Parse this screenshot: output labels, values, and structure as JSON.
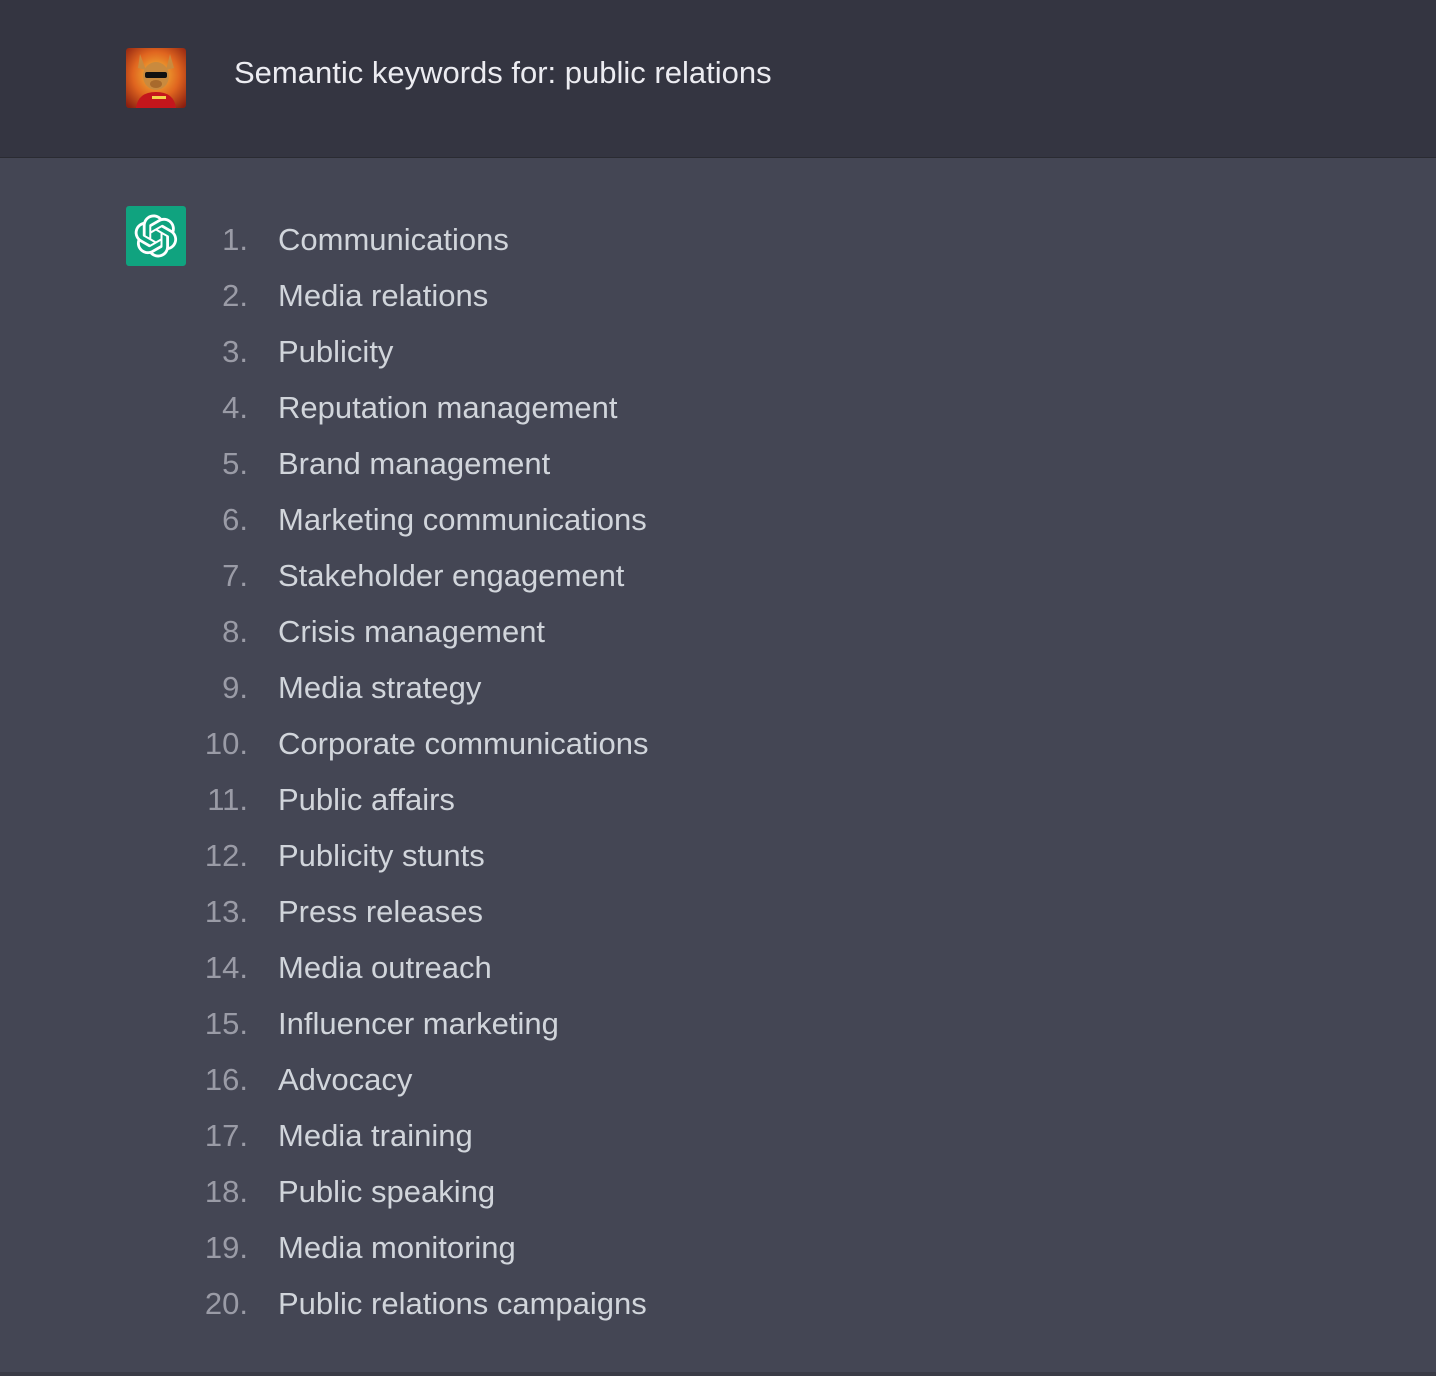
{
  "user_message": {
    "text": "Semantic keywords for: public relations",
    "avatar_icon": "user-avatar-photo"
  },
  "assistant_message": {
    "icon": "openai-logo-icon",
    "icon_bg": "#10a37f",
    "items": [
      {
        "num": "1.",
        "text": "Communications"
      },
      {
        "num": "2.",
        "text": "Media relations"
      },
      {
        "num": "3.",
        "text": "Publicity"
      },
      {
        "num": "4.",
        "text": "Reputation management"
      },
      {
        "num": "5.",
        "text": "Brand management"
      },
      {
        "num": "6.",
        "text": "Marketing communications"
      },
      {
        "num": "7.",
        "text": "Stakeholder engagement"
      },
      {
        "num": "8.",
        "text": "Crisis management"
      },
      {
        "num": "9.",
        "text": "Media strategy"
      },
      {
        "num": "10.",
        "text": "Corporate communications"
      },
      {
        "num": "11.",
        "text": "Public affairs"
      },
      {
        "num": "12.",
        "text": "Publicity stunts"
      },
      {
        "num": "13.",
        "text": "Press releases"
      },
      {
        "num": "14.",
        "text": "Media outreach"
      },
      {
        "num": "15.",
        "text": "Influencer marketing"
      },
      {
        "num": "16.",
        "text": "Advocacy"
      },
      {
        "num": "17.",
        "text": "Media training"
      },
      {
        "num": "18.",
        "text": "Public speaking"
      },
      {
        "num": "19.",
        "text": "Media monitoring"
      },
      {
        "num": "20.",
        "text": "Public relations campaigns"
      }
    ]
  },
  "colors": {
    "user_bg": "#343541",
    "assistant_bg": "#444654",
    "text": "#d1d5db",
    "number": "#9a9ba6"
  }
}
